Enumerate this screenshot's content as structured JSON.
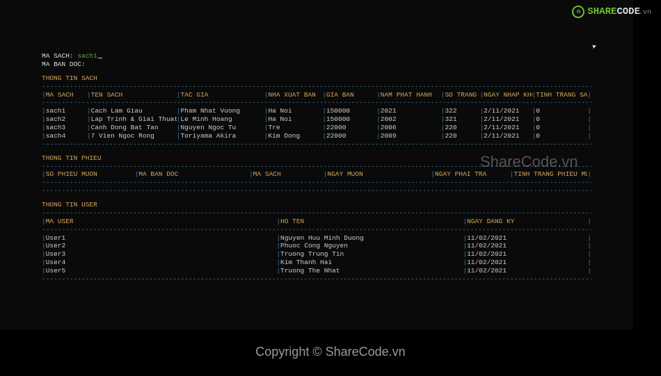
{
  "logo": {
    "share": "SHARE",
    "code": "CODE",
    "vn": ".vn"
  },
  "prompt": {
    "masach_label": "MA SACH: ",
    "masach_value": "sach1",
    "mabandoc_label": "MA BAN DOC:",
    "mabandoc_value": ""
  },
  "sections": {
    "sach_title": "THONG TIN SACH",
    "phieu_title": "THONG TIN PHIEU",
    "user_title": "THONG TIN USER"
  },
  "sach": {
    "headers": [
      "MA SACH",
      "TEN SACH",
      "TAC GIA",
      "NHA XUAT BAN",
      "GIA BAN",
      "NAM PHAT HANH",
      "SO TRANG",
      "NGAY NHAP KHO",
      "TINH TRANG SACH"
    ],
    "rows": [
      [
        "sach1",
        "Cach Lam Giau",
        "Pham Nhat Vuong",
        "Ha Noi",
        "150000",
        "2021",
        "322",
        "2/11/2021",
        "0"
      ],
      [
        "sach2",
        "Lap Trinh & Giai Thuat",
        "Le Minh Hoang",
        "Ha Noi",
        "150000",
        "2002",
        "321",
        "2/11/2021",
        "0"
      ],
      [
        "sach3",
        "Canh Dong Bat Tan",
        "Nguyen Ngoc Tu",
        "Tre",
        "22000",
        "2006",
        "220",
        "2/11/2021",
        "0"
      ],
      [
        "sach4",
        "7 Vien Ngoc Rong",
        "Toriyama Akira",
        "Kim Dong",
        "22000",
        "2009",
        "220",
        "2/11/2021",
        "0"
      ]
    ]
  },
  "phieu": {
    "headers": [
      "SO PHIEU MUON",
      "MA BAN DOC",
      "MA SACH",
      "NGAY MUON",
      "NGAY PHAI TRA",
      "TINH TRANG PHIEU MUON"
    ],
    "rows": []
  },
  "user": {
    "headers": [
      "MA USER",
      "HO TEN",
      "NGAY DANG KY"
    ],
    "rows": [
      [
        "User1",
        "Nguyen Huu Minh Duong",
        "11/02/2021"
      ],
      [
        "User2",
        "Phuoc Cong Nguyen",
        "11/02/2021"
      ],
      [
        "User3",
        "Truong Trung Tin",
        "11/02/2021"
      ],
      [
        "User4",
        "Kim Thanh Hai",
        "11/02/2021"
      ],
      [
        "User5",
        "Truong The Nhat",
        "11/02/2021"
      ]
    ]
  },
  "watermark": "ShareCode.vn",
  "footer": "Copyright © ShareCode.vn",
  "dashes": "----------------------------------------------------------------------------------------------------------------------------------------------------------------------"
}
